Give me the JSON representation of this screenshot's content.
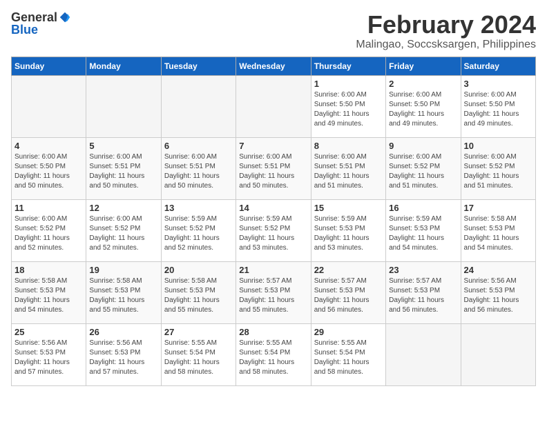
{
  "header": {
    "logo_general": "General",
    "logo_blue": "Blue",
    "month": "February 2024",
    "location": "Malingao, Soccsksargen, Philippines"
  },
  "columns": [
    "Sunday",
    "Monday",
    "Tuesday",
    "Wednesday",
    "Thursday",
    "Friday",
    "Saturday"
  ],
  "weeks": [
    [
      {
        "day": "",
        "text": ""
      },
      {
        "day": "",
        "text": ""
      },
      {
        "day": "",
        "text": ""
      },
      {
        "day": "",
        "text": ""
      },
      {
        "day": "1",
        "text": "Sunrise: 6:00 AM\nSunset: 5:50 PM\nDaylight: 11 hours\nand 49 minutes."
      },
      {
        "day": "2",
        "text": "Sunrise: 6:00 AM\nSunset: 5:50 PM\nDaylight: 11 hours\nand 49 minutes."
      },
      {
        "day": "3",
        "text": "Sunrise: 6:00 AM\nSunset: 5:50 PM\nDaylight: 11 hours\nand 49 minutes."
      }
    ],
    [
      {
        "day": "4",
        "text": "Sunrise: 6:00 AM\nSunset: 5:50 PM\nDaylight: 11 hours\nand 50 minutes."
      },
      {
        "day": "5",
        "text": "Sunrise: 6:00 AM\nSunset: 5:51 PM\nDaylight: 11 hours\nand 50 minutes."
      },
      {
        "day": "6",
        "text": "Sunrise: 6:00 AM\nSunset: 5:51 PM\nDaylight: 11 hours\nand 50 minutes."
      },
      {
        "day": "7",
        "text": "Sunrise: 6:00 AM\nSunset: 5:51 PM\nDaylight: 11 hours\nand 50 minutes."
      },
      {
        "day": "8",
        "text": "Sunrise: 6:00 AM\nSunset: 5:51 PM\nDaylight: 11 hours\nand 51 minutes."
      },
      {
        "day": "9",
        "text": "Sunrise: 6:00 AM\nSunset: 5:52 PM\nDaylight: 11 hours\nand 51 minutes."
      },
      {
        "day": "10",
        "text": "Sunrise: 6:00 AM\nSunset: 5:52 PM\nDaylight: 11 hours\nand 51 minutes."
      }
    ],
    [
      {
        "day": "11",
        "text": "Sunrise: 6:00 AM\nSunset: 5:52 PM\nDaylight: 11 hours\nand 52 minutes."
      },
      {
        "day": "12",
        "text": "Sunrise: 6:00 AM\nSunset: 5:52 PM\nDaylight: 11 hours\nand 52 minutes."
      },
      {
        "day": "13",
        "text": "Sunrise: 5:59 AM\nSunset: 5:52 PM\nDaylight: 11 hours\nand 52 minutes."
      },
      {
        "day": "14",
        "text": "Sunrise: 5:59 AM\nSunset: 5:52 PM\nDaylight: 11 hours\nand 53 minutes."
      },
      {
        "day": "15",
        "text": "Sunrise: 5:59 AM\nSunset: 5:53 PM\nDaylight: 11 hours\nand 53 minutes."
      },
      {
        "day": "16",
        "text": "Sunrise: 5:59 AM\nSunset: 5:53 PM\nDaylight: 11 hours\nand 54 minutes."
      },
      {
        "day": "17",
        "text": "Sunrise: 5:58 AM\nSunset: 5:53 PM\nDaylight: 11 hours\nand 54 minutes."
      }
    ],
    [
      {
        "day": "18",
        "text": "Sunrise: 5:58 AM\nSunset: 5:53 PM\nDaylight: 11 hours\nand 54 minutes."
      },
      {
        "day": "19",
        "text": "Sunrise: 5:58 AM\nSunset: 5:53 PM\nDaylight: 11 hours\nand 55 minutes."
      },
      {
        "day": "20",
        "text": "Sunrise: 5:58 AM\nSunset: 5:53 PM\nDaylight: 11 hours\nand 55 minutes."
      },
      {
        "day": "21",
        "text": "Sunrise: 5:57 AM\nSunset: 5:53 PM\nDaylight: 11 hours\nand 55 minutes."
      },
      {
        "day": "22",
        "text": "Sunrise: 5:57 AM\nSunset: 5:53 PM\nDaylight: 11 hours\nand 56 minutes."
      },
      {
        "day": "23",
        "text": "Sunrise: 5:57 AM\nSunset: 5:53 PM\nDaylight: 11 hours\nand 56 minutes."
      },
      {
        "day": "24",
        "text": "Sunrise: 5:56 AM\nSunset: 5:53 PM\nDaylight: 11 hours\nand 56 minutes."
      }
    ],
    [
      {
        "day": "25",
        "text": "Sunrise: 5:56 AM\nSunset: 5:53 PM\nDaylight: 11 hours\nand 57 minutes."
      },
      {
        "day": "26",
        "text": "Sunrise: 5:56 AM\nSunset: 5:53 PM\nDaylight: 11 hours\nand 57 minutes."
      },
      {
        "day": "27",
        "text": "Sunrise: 5:55 AM\nSunset: 5:54 PM\nDaylight: 11 hours\nand 58 minutes."
      },
      {
        "day": "28",
        "text": "Sunrise: 5:55 AM\nSunset: 5:54 PM\nDaylight: 11 hours\nand 58 minutes."
      },
      {
        "day": "29",
        "text": "Sunrise: 5:55 AM\nSunset: 5:54 PM\nDaylight: 11 hours\nand 58 minutes."
      },
      {
        "day": "",
        "text": ""
      },
      {
        "day": "",
        "text": ""
      }
    ]
  ]
}
